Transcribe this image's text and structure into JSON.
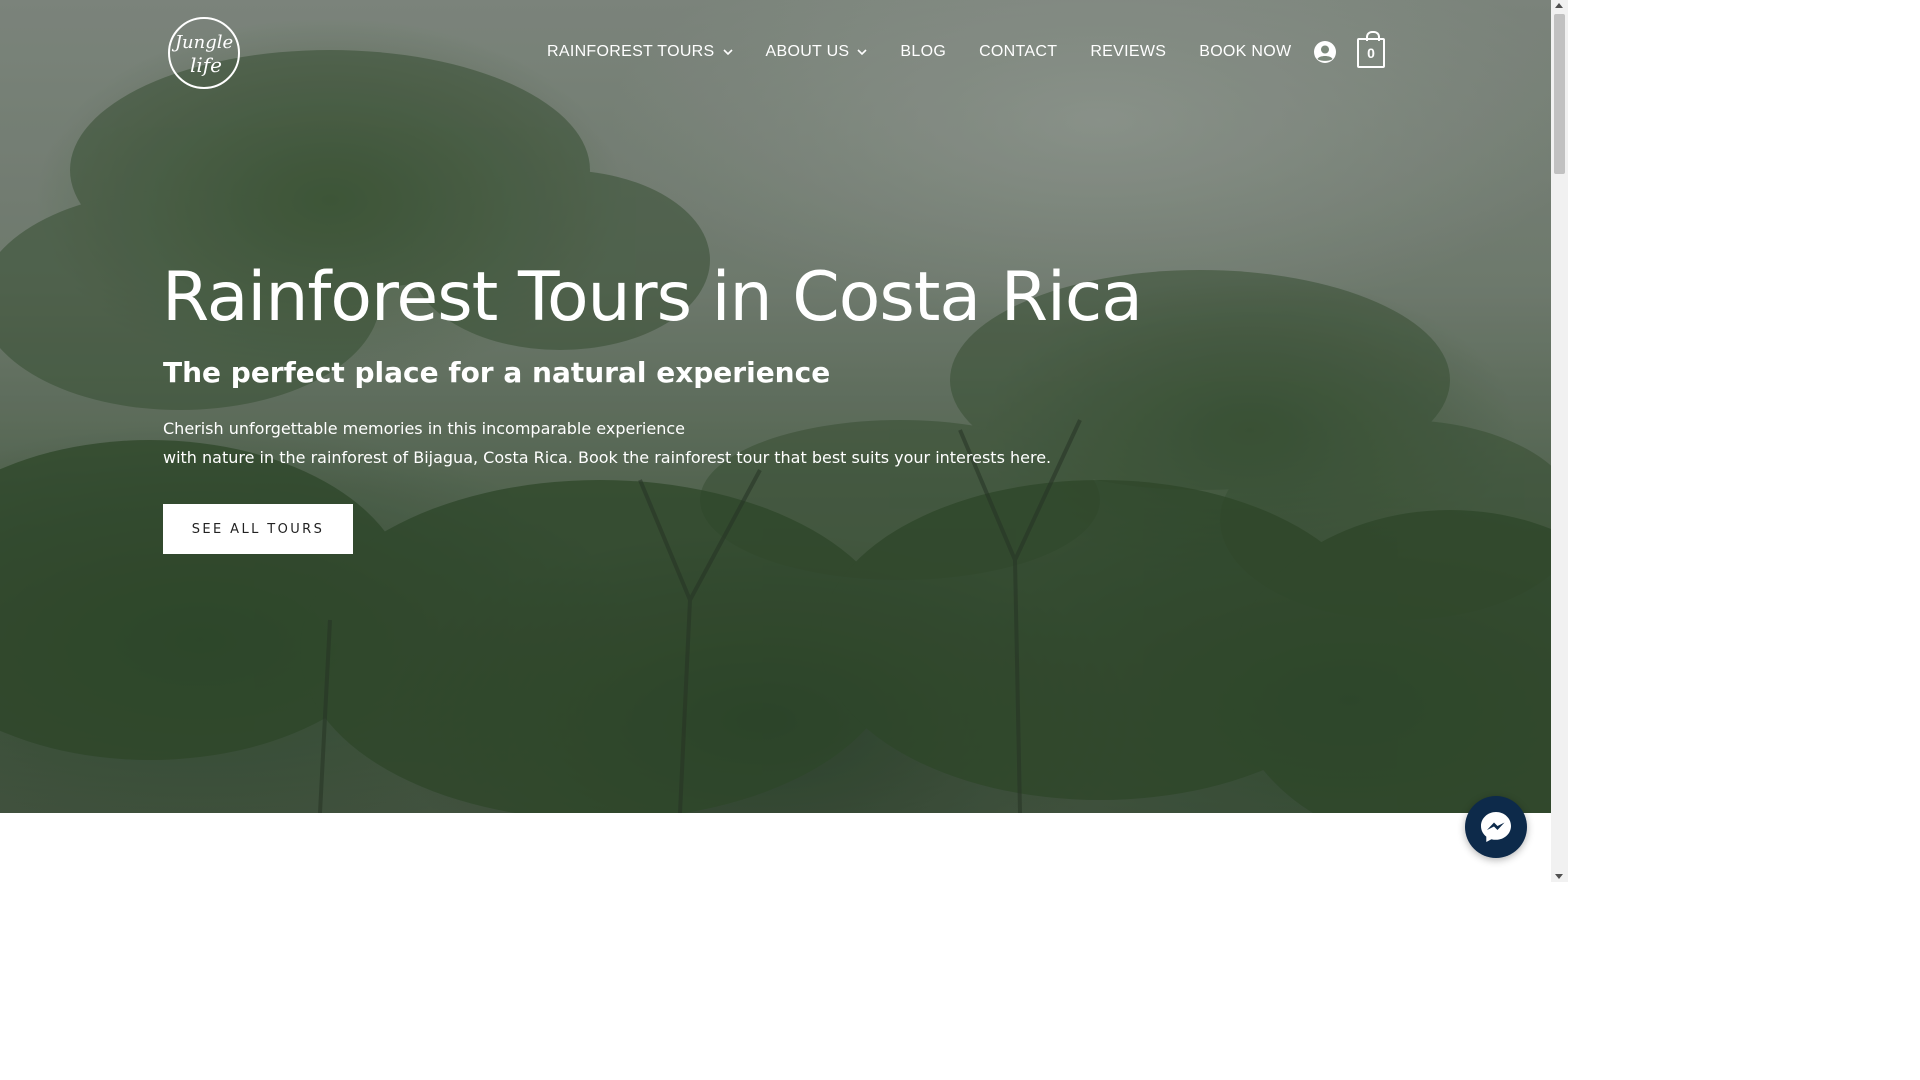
{
  "brand": {
    "logo_text_line1": "Jungle",
    "logo_text_line2": "life",
    "logo_icon": "jungle-life-logo"
  },
  "nav": {
    "items": [
      {
        "label": "RAINFOREST TOURS",
        "has_dropdown": true
      },
      {
        "label": "ABOUT US",
        "has_dropdown": true
      },
      {
        "label": "BLOG",
        "has_dropdown": false
      },
      {
        "label": "CONTACT",
        "has_dropdown": false
      },
      {
        "label": "REVIEWS",
        "has_dropdown": false
      },
      {
        "label": "BOOK NOW",
        "has_dropdown": false
      }
    ],
    "account_icon": "account-icon",
    "cart_icon": "shopping-bag-icon",
    "cart_count": "0"
  },
  "hero": {
    "title": "Rainforest Tours in Costa Rica",
    "subtitle": "The perfect place for a natural experience",
    "description_line1": "Cherish unforgettable memories in this incomparable experience",
    "description_line2": "with nature in the rainforest of Bijagua, Costa Rica. Book the rainforest tour that best suits your interests here.",
    "cta_label": "SEE ALL TOURS"
  },
  "widgets": {
    "messenger_icon": "messenger-icon"
  },
  "colors": {
    "text_on_hero": "#ffffff",
    "cta_bg": "#ffffff",
    "cta_text": "#222222",
    "messenger_bg": "#0d2a4a"
  }
}
